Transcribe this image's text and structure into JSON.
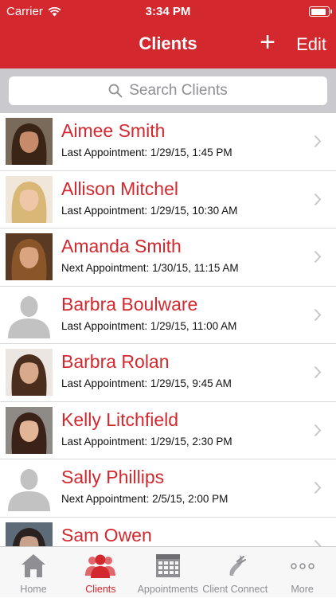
{
  "status": {
    "carrier": "Carrier",
    "time": "3:34 PM"
  },
  "nav": {
    "title": "Clients",
    "add_label": "+",
    "edit_label": "Edit"
  },
  "search": {
    "placeholder": "Search Clients"
  },
  "clients": [
    {
      "name": "Aimee Smith",
      "appointment": "Last Appointment: 1/29/15, 1:45 PM",
      "photo": "photo",
      "skin": "#c58b6a",
      "hair": "#3a2416",
      "bg": "#7a6a5a"
    },
    {
      "name": "Allison Mitchel",
      "appointment": "Last Appointment: 1/29/15, 10:30 AM",
      "photo": "photo",
      "skin": "#eec7a6",
      "hair": "#d9b777",
      "bg": "#f1e6da"
    },
    {
      "name": "Amanda Smith",
      "appointment": "Next Appointment: 1/30/15, 11:15 AM",
      "photo": "photo",
      "skin": "#d9a47f",
      "hair": "#8a5528",
      "bg": "#5a3a22"
    },
    {
      "name": "Barbra Boulware",
      "appointment": "Last Appointment: 1/29/15, 11:00 AM",
      "photo": "placeholder"
    },
    {
      "name": "Barbra Rolan",
      "appointment": "Last Appointment: 1/29/15, 9:45 AM",
      "photo": "photo",
      "skin": "#d8a98a",
      "hair": "#4a2d1c",
      "bg": "#ece6e2"
    },
    {
      "name": "Kelly Litchfield",
      "appointment": "Last Appointment: 1/29/15, 2:30 PM",
      "photo": "photo",
      "skin": "#e3b597",
      "hair": "#3b2218",
      "bg": "#8e8a86"
    },
    {
      "name": "Sally Phillips",
      "appointment": "Next Appointment: 2/5/15, 2:00 PM",
      "photo": "placeholder"
    },
    {
      "name": "Sam Owen",
      "appointment": "",
      "photo": "photo",
      "skin": "#c9a08a",
      "hair": "#2a2220",
      "bg": "#5d6a78"
    }
  ],
  "tabs": [
    {
      "label": "Home",
      "icon": "home-icon",
      "active": false
    },
    {
      "label": "Clients",
      "icon": "clients-icon",
      "active": true
    },
    {
      "label": "Appointments",
      "icon": "calendar-icon",
      "active": false
    },
    {
      "label": "Client Connect",
      "icon": "client-connect-icon",
      "active": false
    },
    {
      "label": "More",
      "icon": "more-icon",
      "active": false
    }
  ],
  "colors": {
    "brand": "#d3282e",
    "tab_inactive": "#8e8e93",
    "search_bar": "#c9c9ce",
    "placeholder_avatar": "#c2c2c2"
  }
}
